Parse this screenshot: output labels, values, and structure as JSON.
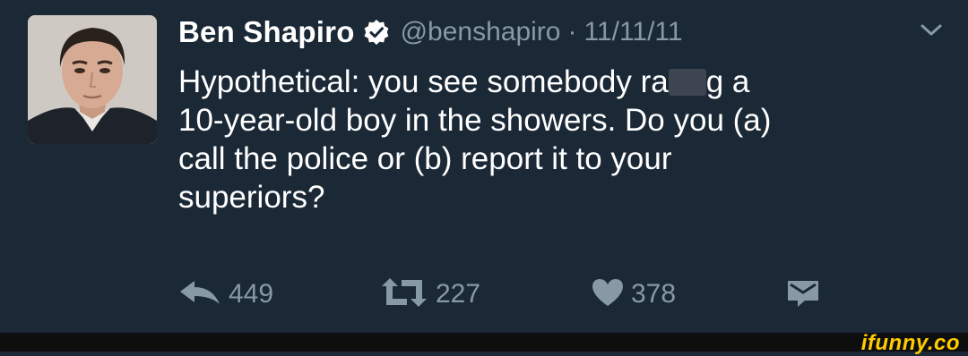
{
  "tweet": {
    "name": "Ben Shapiro",
    "handle": "@benshapiro",
    "separator": "·",
    "date": "11/11/11",
    "text_lines": [
      [
        "Hypothetical: you see somebody ra",
        "g a"
      ],
      "10-year-old boy in the showers. Do you (a)",
      "call the police or (b) report it to your",
      "superiors?"
    ],
    "actions": {
      "reply_count": "449",
      "retweet_count": "227",
      "like_count": "378"
    }
  },
  "watermark": "ifunny.co",
  "colors": {
    "background": "#1b2836",
    "text": "#ffffff",
    "muted": "#8899a6",
    "watermark": "#ffcc00"
  },
  "icons": [
    "verified-badge-icon",
    "chevron-down-icon",
    "reply-icon",
    "retweet-icon",
    "heart-icon",
    "direct-message-icon"
  ]
}
